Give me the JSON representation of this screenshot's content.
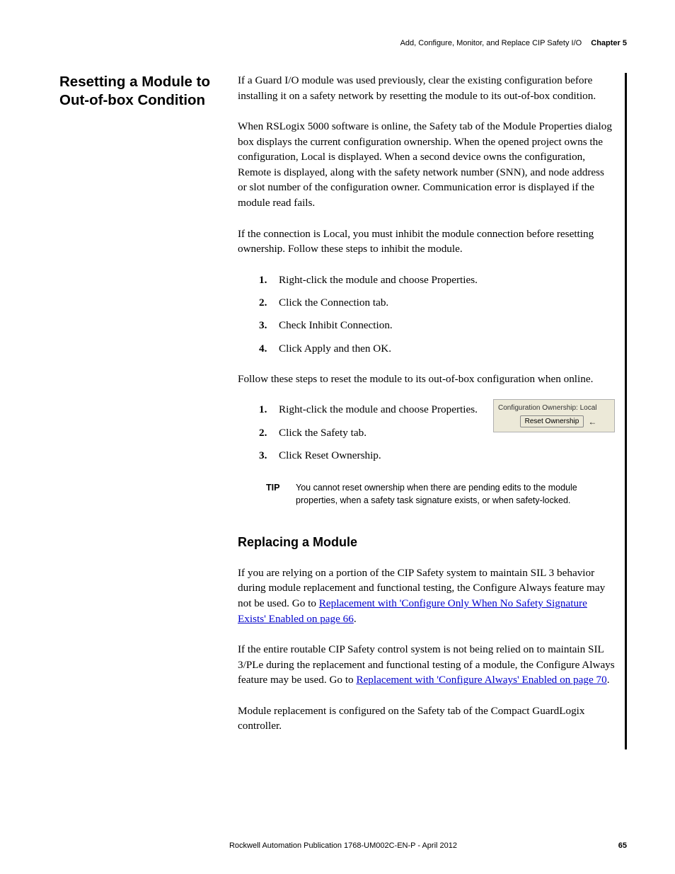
{
  "header": {
    "title": "Add, Configure, Monitor, and Replace CIP Safety I/O",
    "chapter": "Chapter 5"
  },
  "left": {
    "heading": "Resetting a Module to Out-of-box Condition"
  },
  "body": {
    "p1": "If a Guard I/O module was used previously, clear the existing configuration before installing it on a safety network by resetting the module to its out-of-box condition.",
    "p2": "When RSLogix 5000 software is online, the Safety tab of the Module Properties dialog box displays the current configuration ownership. When the opened project owns the configuration, Local is displayed. When a second device owns the configuration, Remote is displayed, along with the safety network number (SNN), and node address or slot number of the configuration owner. Communication error is displayed if the module read fails.",
    "p3": "If the connection is Local, you must inhibit the module connection before resetting ownership. Follow these steps to inhibit the module.",
    "steps1": [
      "Right-click the module and choose Properties.",
      "Click the Connection tab.",
      "Check Inhibit Connection.",
      "Click Apply and then OK."
    ],
    "p4": "Follow these steps to reset the module to its out-of-box configuration when online.",
    "steps2": [
      "Right-click the module and choose Properties.",
      "Click the Safety tab.",
      "Click Reset Ownership."
    ],
    "ui": {
      "label": "Configuration Ownership: Local",
      "button": "Reset Ownership"
    },
    "tip": {
      "label": "TIP",
      "text": "You cannot reset ownership when there are pending edits to the module properties, when a safety task signature exists, or when safety-locked."
    },
    "sub_heading": "Replacing a Module",
    "p5a": "If you are relying on a portion of the CIP Safety system to maintain SIL 3 behavior during module replacement and functional testing, the Configure Always feature may not be used. Go to ",
    "link1": "Replacement with 'Configure Only When No Safety Signature Exists' Enabled on page 66",
    "p5b": ".",
    "p6a": "If the entire routable CIP Safety control system is not being relied on to maintain SIL 3/PLe during the replacement and functional testing of a module, the Configure Always feature may be used. Go to ",
    "link2": "Replacement with 'Configure Always' Enabled on page 70",
    "p6b": ".",
    "p7": "Module replacement is configured on the Safety tab of the Compact GuardLogix controller."
  },
  "footer": {
    "publication": "Rockwell Automation Publication 1768-UM002C-EN-P - April 2012",
    "page": "65"
  }
}
